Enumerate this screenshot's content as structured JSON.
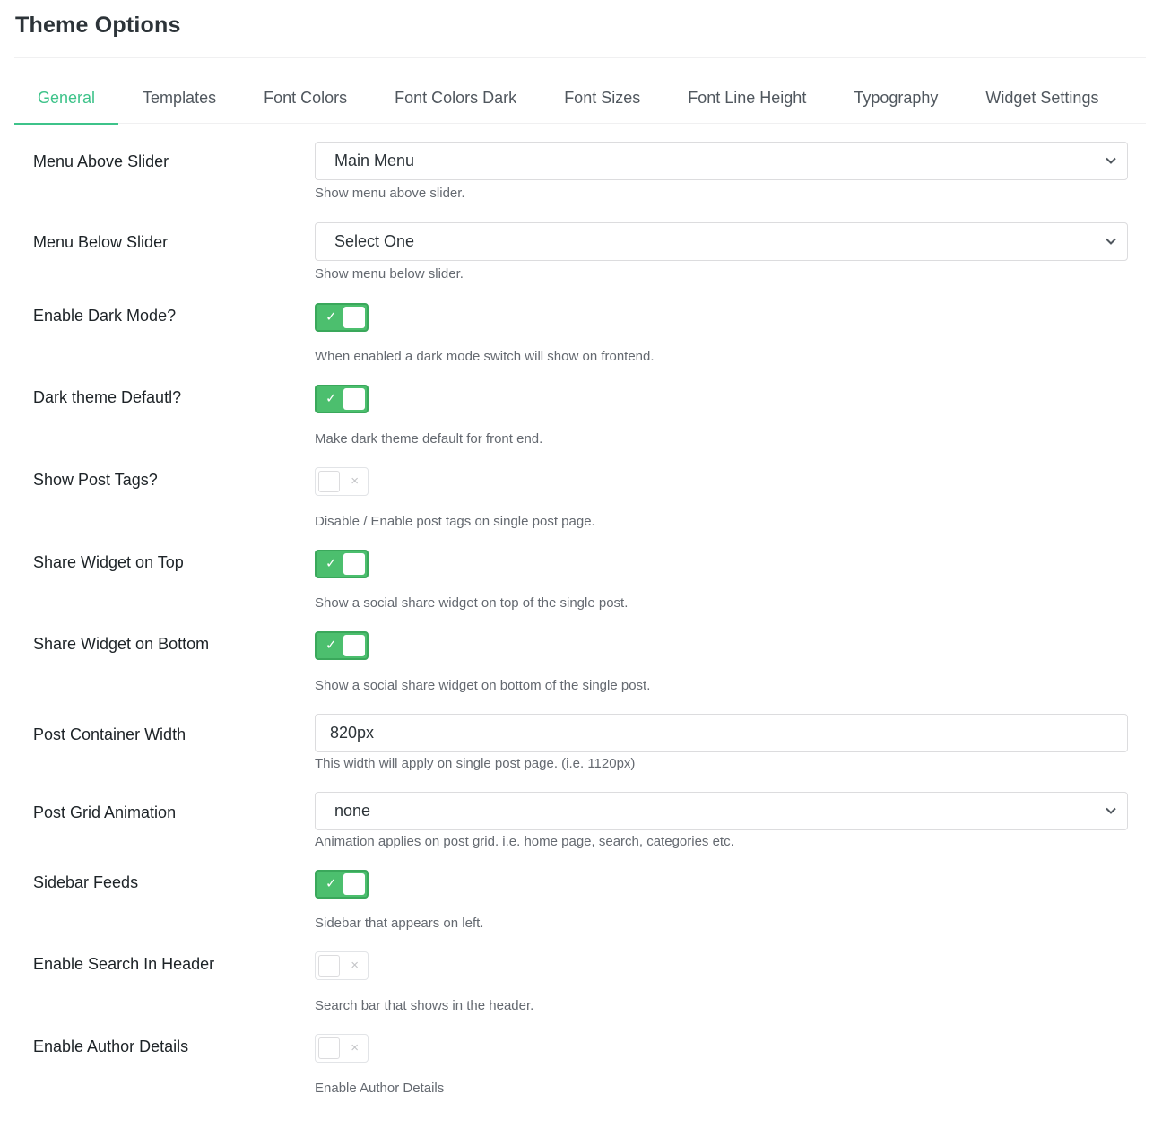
{
  "page": {
    "title": "Theme Options"
  },
  "tabs": [
    {
      "label": "General",
      "active": true
    },
    {
      "label": "Templates"
    },
    {
      "label": "Font Colors"
    },
    {
      "label": "Font Colors Dark"
    },
    {
      "label": "Font Sizes"
    },
    {
      "label": "Font Line Height"
    },
    {
      "label": "Typography"
    },
    {
      "label": "Widget Settings"
    }
  ],
  "colors": {
    "accent": "#3ec38a",
    "toggle_on": "#4cbf6e",
    "toggle_off": "#ffffff"
  },
  "settings": {
    "menu_above_slider": {
      "label": "Menu Above Slider",
      "value": "Main Menu",
      "help": "Show menu above slider."
    },
    "menu_below_slider": {
      "label": "Menu Below Slider",
      "value": "Select One",
      "help": "Show menu below slider."
    },
    "enable_dark_mode": {
      "label": "Enable Dark Mode?",
      "on": true,
      "mark": "✓",
      "help": "When enabled a dark mode switch will show on frontend."
    },
    "dark_theme_default": {
      "label": "Dark theme Defautl?",
      "on": true,
      "mark": "✓",
      "help": "Make dark theme default for front end."
    },
    "show_post_tags": {
      "label": "Show Post Tags?",
      "on": false,
      "mark": "×",
      "help": "Disable / Enable post tags on single post page."
    },
    "share_widget_top": {
      "label": "Share Widget on Top",
      "on": true,
      "mark": "✓",
      "help": "Show a social share widget on top of the single post."
    },
    "share_widget_bottom": {
      "label": "Share Widget on Bottom",
      "on": true,
      "mark": "✓",
      "help": "Show a social share widget on bottom of the single post."
    },
    "post_container_width": {
      "label": "Post Container Width",
      "value": "820px",
      "help": "This width will apply on single post page. (i.e. 1120px)"
    },
    "post_grid_animation": {
      "label": "Post Grid Animation",
      "value": "none",
      "help": "Animation applies on post grid. i.e. home page, search, categories etc."
    },
    "sidebar_feeds": {
      "label": "Sidebar Feeds",
      "on": true,
      "mark": "✓",
      "help": "Sidebar that appears on left."
    },
    "enable_search_header": {
      "label": "Enable Search In Header",
      "on": false,
      "mark": "×",
      "help": "Search bar that shows in the header."
    },
    "enable_author_details": {
      "label": "Enable Author Details",
      "on": false,
      "mark": "×",
      "help": "Enable Author Details"
    }
  }
}
